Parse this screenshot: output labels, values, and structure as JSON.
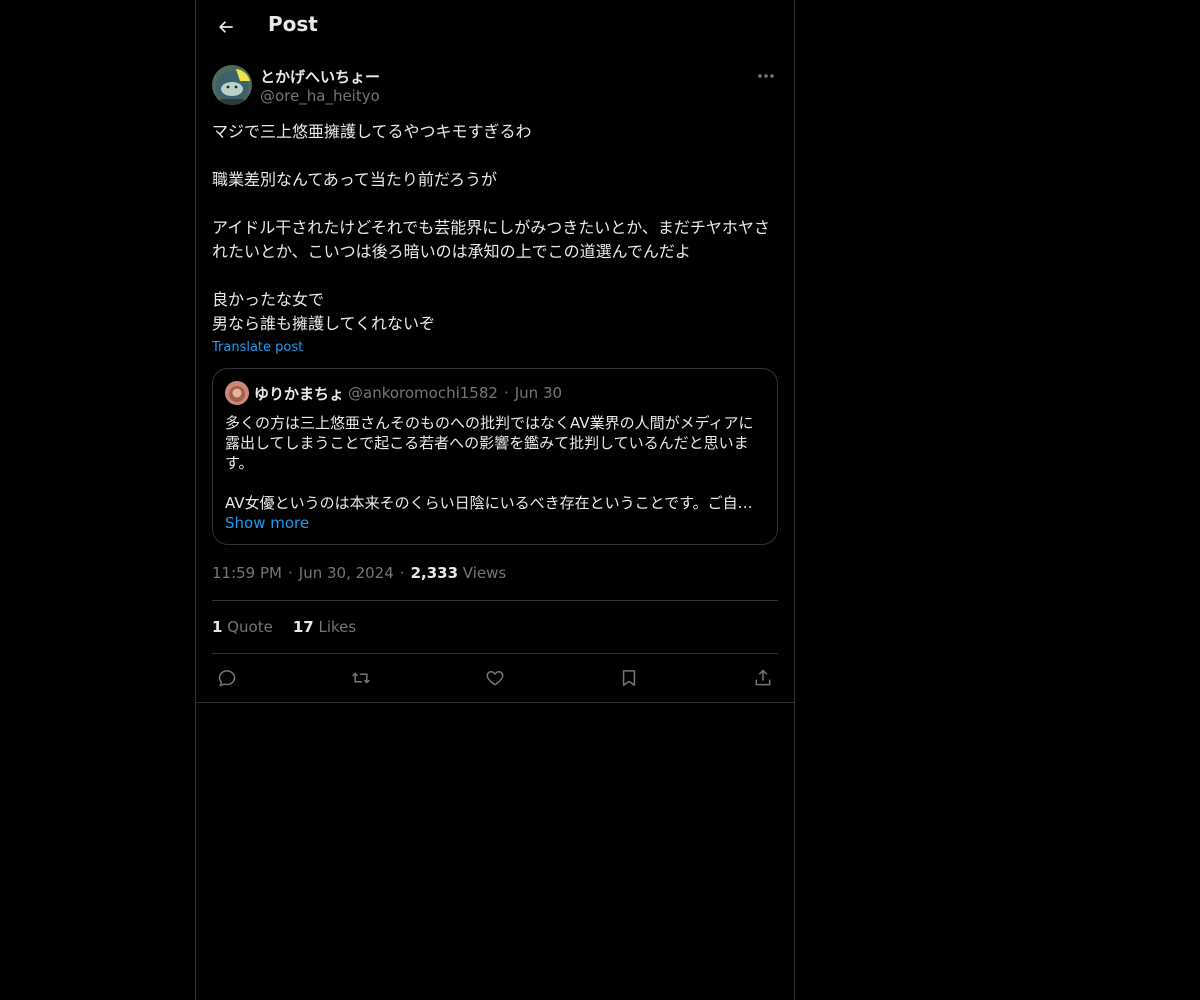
{
  "header": {
    "title": "Post"
  },
  "post": {
    "author_name": "とかげへいちょー",
    "author_handle": "@ore_ha_heityo",
    "text": "マジで三上悠亜擁護してるやつキモすぎるわ\n\n職業差別なんてあって当たり前だろうが\n\nアイドル干されたけどそれでも芸能界にしがみつきたいとか、まだチヤホヤされたいとか、こいつは後ろ暗いのは承知の上でこの道選んでんだよ\n\n良かったな女で\n男なら誰も擁護してくれないぞ",
    "translate_label": "Translate post",
    "time": "11:59 PM",
    "date": "Jun 30, 2024",
    "views_count": "2,333",
    "views_label": "Views",
    "quotes_count": "1",
    "quotes_label": "Quote",
    "likes_count": "17",
    "likes_label": "Likes"
  },
  "quote": {
    "name": "ゆりかまちょ",
    "handle": "@ankoromochi1582",
    "date": "Jun 30",
    "text": "多くの方は三上悠亜さんそのものへの批判ではなくAV業界の人間がメディアに露出してしまうことで起こる若者への影響を鑑みて批判しているんだと思います。",
    "text_last": "AV女優というのは本来そのくらい日陰にいるべき存在ということです。ご自身…",
    "show_more": "Show more"
  },
  "colors": {
    "accent": "#1d9bf0",
    "background": "#000000",
    "border": "#2f3336",
    "muted": "#71767b"
  },
  "icons": [
    "back-arrow-icon",
    "more-icon",
    "reply-icon",
    "repost-icon",
    "like-icon",
    "bookmark-icon",
    "share-icon"
  ]
}
